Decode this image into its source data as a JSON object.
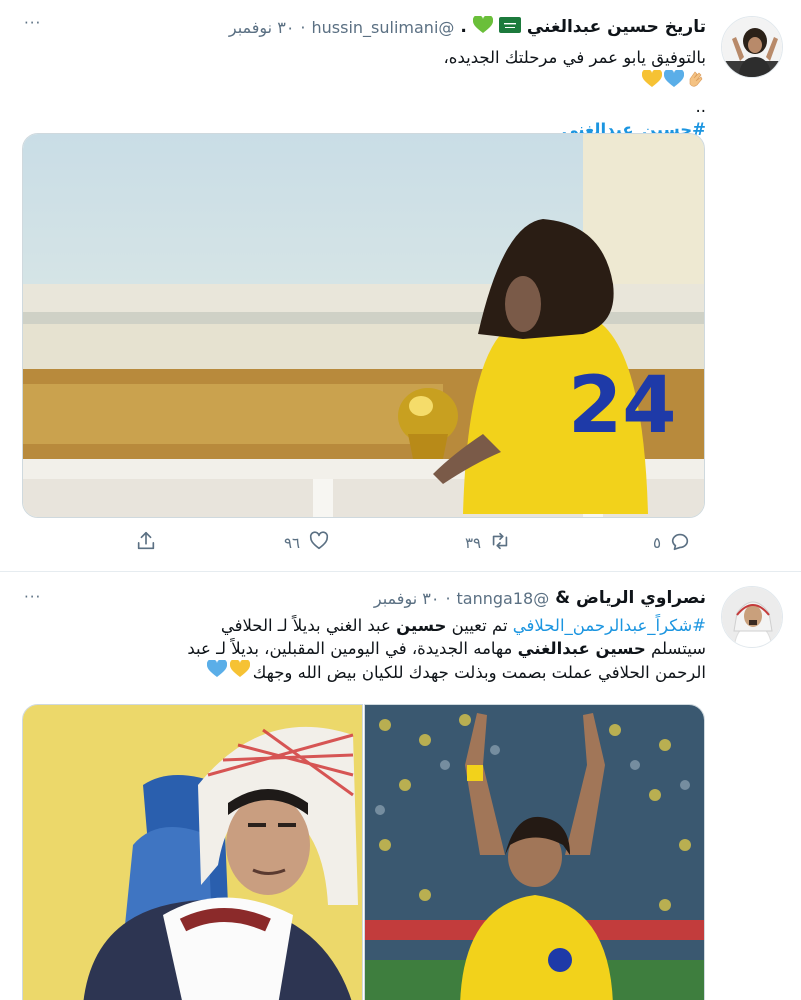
{
  "tweet1": {
    "author_name": "تاريخ حسين عبدالغني",
    "author_suffix": ".",
    "handle": "@hussin_sulimani",
    "time": "٣٠ نوفمبر",
    "line1": "بالتوفيق يابو عمر في مرحلتك الجديده،",
    "line2_text": "..",
    "hashtag": "#حسين_عبدالغني",
    "reply_count": "٥",
    "retweet_count": "٣٩",
    "like_count": "٩٦",
    "jersey_number": "24"
  },
  "tweet2": {
    "author_name": "نصراوي الرياض &",
    "handle": "@tannga18",
    "time": "٣٠ نوفمبر",
    "hashtag": "#شكراً_عبدالرحمن_الحلافي",
    "l1_a": "تم تعيين",
    "l1_b": "حسين",
    "l1_c": "عبد الغني بديلاً لـ الحلافي",
    "l2_a": "سيتسلم",
    "l2_b": "حسين عبدالغني",
    "l2_c": "مهامه الجديدة، في اليومين المقبلين، بديلاً لـ عبد",
    "l3": "الرحمن الحلافي عملت بصمت وبذلت جهدك للكيان بيض الله وجهك"
  },
  "dot": "·",
  "more_label": "···",
  "colors": {
    "accent": "#1b95e0",
    "muted": "#5b7083",
    "nassr_yellow": "#f4d21c",
    "nassr_blue": "#1e3aa8"
  }
}
